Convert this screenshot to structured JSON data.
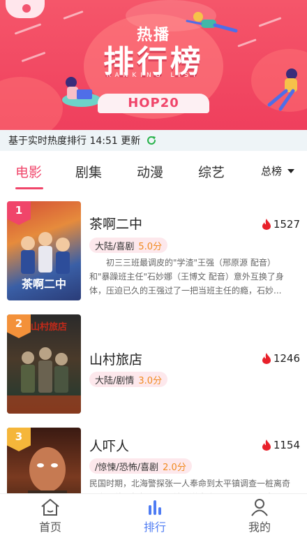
{
  "banner": {
    "title_top": "热播",
    "title_main": "排行榜",
    "title_sub": "RANKING LIST",
    "badge": "HOP20"
  },
  "update_bar": {
    "text": "基于实时热度排行 14:51 更新"
  },
  "tabs": [
    {
      "label": "电影",
      "active": true
    },
    {
      "label": "剧集",
      "active": false
    },
    {
      "label": "动漫",
      "active": false
    },
    {
      "label": "综艺",
      "active": false
    }
  ],
  "dropdown": {
    "label": "总榜"
  },
  "colors": {
    "accent": "#f0456a",
    "nav_active": "#4f7cf3",
    "score": "#f08a20",
    "heat_icon": "#e8202a"
  },
  "items": [
    {
      "rank": "1",
      "rank_color": "#f0456a",
      "title": "茶啊二中",
      "heat": "1527",
      "tag": "大陆/喜剧",
      "score": "5.0分",
      "desc": "初三三班最调皮的\"学渣\"王强（邢原源 配音）和\"暴躁班主任\"石妙娜（王博文 配音）意外互换了身体，压迫已久的王强过了一把当班主任的瘾，石妙..."
    },
    {
      "rank": "2",
      "rank_color": "#f3913a",
      "title": "山村旅店",
      "heat": "1246",
      "tag": "大陆/剧情",
      "score": "3.0分",
      "desc": ""
    },
    {
      "rank": "3",
      "rank_color": "#f5b63a",
      "title": "人吓人",
      "heat": "1154",
      "tag": "/惊悚/恐怖/喜剧",
      "score": "2.0分",
      "desc": "民国时期，北海警探张一人奉命到太平镇调查一桩离奇凶案，他只根据作目小镇到送来会，个张，人调查"
    }
  ],
  "bottom_nav": [
    {
      "label": "首页",
      "icon": "home-icon",
      "active": false
    },
    {
      "label": "排行",
      "icon": "ranking-icon",
      "active": true
    },
    {
      "label": "我的",
      "icon": "profile-icon",
      "active": false
    }
  ]
}
